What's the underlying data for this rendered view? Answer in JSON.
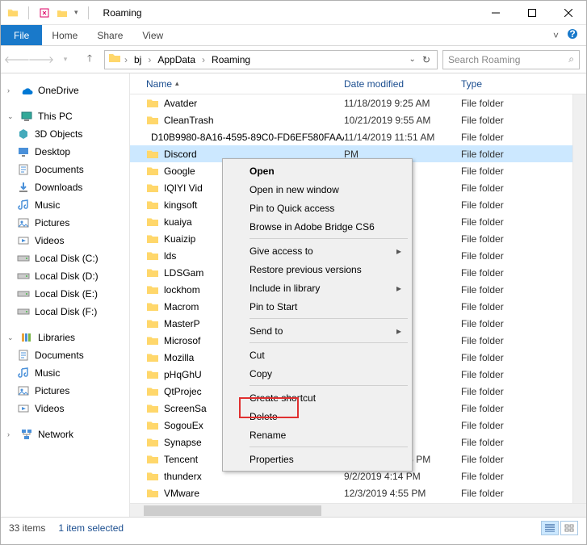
{
  "window": {
    "title": "Roaming"
  },
  "ribbon": {
    "file": "File",
    "tabs": [
      "Home",
      "Share",
      "View"
    ]
  },
  "breadcrumb": [
    "bj",
    "AppData",
    "Roaming"
  ],
  "search": {
    "placeholder": "Search Roaming"
  },
  "sidebar": {
    "sections": [
      {
        "root": "OneDrive",
        "items": []
      },
      {
        "root": "This PC",
        "items": [
          "3D Objects",
          "Desktop",
          "Documents",
          "Downloads",
          "Music",
          "Pictures",
          "Videos",
          "Local Disk (C:)",
          "Local Disk (D:)",
          "Local Disk  (E:)",
          "Local Disk (F:)"
        ]
      },
      {
        "root": "Libraries",
        "items": [
          "Documents",
          "Music",
          "Pictures",
          "Videos"
        ]
      },
      {
        "root": "Network",
        "items": []
      }
    ]
  },
  "cols": {
    "name": "Name",
    "date": "Date modified",
    "type": "Type"
  },
  "rows": [
    {
      "name": "Avatder",
      "date": "11/18/2019 9:25 AM",
      "type": "File folder"
    },
    {
      "name": "CleanTrash",
      "date": "10/21/2019 9:55 AM",
      "type": "File folder"
    },
    {
      "name": "D10B9980-8A16-4595-89C0-FD6EF580FAAA",
      "date": "11/14/2019 11:51 AM",
      "type": "File folder"
    },
    {
      "name": "Discord",
      "date": "PM",
      "type": "File folder",
      "selected": true
    },
    {
      "name": "Google",
      "date": "PM",
      "type": "File folder"
    },
    {
      "name": "IQIYI Vid",
      "date": "0 PM",
      "type": "File folder"
    },
    {
      "name": "kingsoft",
      "date": "PM",
      "type": "File folder"
    },
    {
      "name": "kuaiya",
      "date": "PM",
      "type": "File folder"
    },
    {
      "name": "Kuaizip",
      "date": "PM",
      "type": "File folder"
    },
    {
      "name": "lds",
      "date": "PM",
      "type": "File folder"
    },
    {
      "name": "LDSGam",
      "date": "PM",
      "type": "File folder"
    },
    {
      "name": "lockhom",
      "date": "3 AM",
      "type": "File folder"
    },
    {
      "name": "Macrom",
      "date": "3 AM",
      "type": "File folder"
    },
    {
      "name": "MasterP",
      "date": "1 AM",
      "type": "File folder"
    },
    {
      "name": "Microsof",
      "date": "PM",
      "type": "File folder"
    },
    {
      "name": "Mozilla",
      "date": "4 AM",
      "type": "File folder"
    },
    {
      "name": "pHqGhU",
      "date": "PM",
      "type": "File folder"
    },
    {
      "name": "QtProjec",
      "date": "PM",
      "type": "File folder"
    },
    {
      "name": "ScreenSa",
      "date": "PM",
      "type": "File folder"
    },
    {
      "name": "SogouEx",
      "date": "PM",
      "type": "File folder"
    },
    {
      "name": "Synapse",
      "date": "3 PM",
      "type": "File folder"
    },
    {
      "name": "Tencent",
      "date": "11/14/2019 1:46 PM",
      "type": "File folder"
    },
    {
      "name": "thunderx",
      "date": "9/2/2019 4:14 PM",
      "type": "File folder"
    },
    {
      "name": "VMware",
      "date": "12/3/2019 4:55 PM",
      "type": "File folder"
    }
  ],
  "context_menu": {
    "items": [
      {
        "label": "Open",
        "bold": true
      },
      {
        "label": "Open in new window"
      },
      {
        "label": "Pin to Quick access"
      },
      {
        "label": "Browse in Adobe Bridge CS6"
      },
      {
        "sep": true
      },
      {
        "label": "Give access to",
        "sub": true
      },
      {
        "label": "Restore previous versions"
      },
      {
        "label": "Include in library",
        "sub": true
      },
      {
        "label": "Pin to Start"
      },
      {
        "sep": true
      },
      {
        "label": "Send to",
        "sub": true
      },
      {
        "sep": true
      },
      {
        "label": "Cut"
      },
      {
        "label": "Copy"
      },
      {
        "sep": true
      },
      {
        "label": "Create shortcut"
      },
      {
        "label": "Delete"
      },
      {
        "label": "Rename"
      },
      {
        "sep": true
      },
      {
        "label": "Properties"
      }
    ]
  },
  "status": {
    "count": "33 items",
    "selected": "1 item selected"
  }
}
